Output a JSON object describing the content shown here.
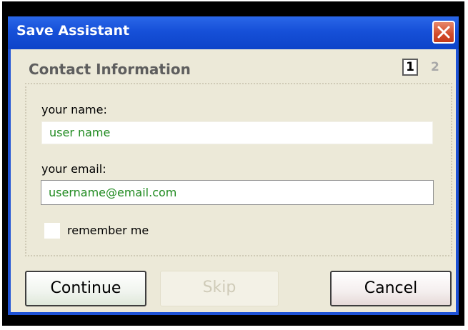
{
  "window": {
    "title": "Save Assistant",
    "close_icon": "close-x-icon"
  },
  "section": {
    "title": "Contact Information",
    "step_current": "1",
    "step_next": "2"
  },
  "form": {
    "name_label": "your name:",
    "name_value": "user name",
    "email_label": "your email:",
    "email_value": "username@email.com",
    "remember_label": "remember me",
    "remember_checked": false
  },
  "buttons": {
    "continue_label": "Continue",
    "skip_label": "Skip",
    "cancel_label": "Cancel"
  },
  "colors": {
    "titlebar": "#1650d8",
    "window_bg": "#ece9d8",
    "input_text": "#1f8a1f",
    "close_button": "#d24b2a"
  }
}
